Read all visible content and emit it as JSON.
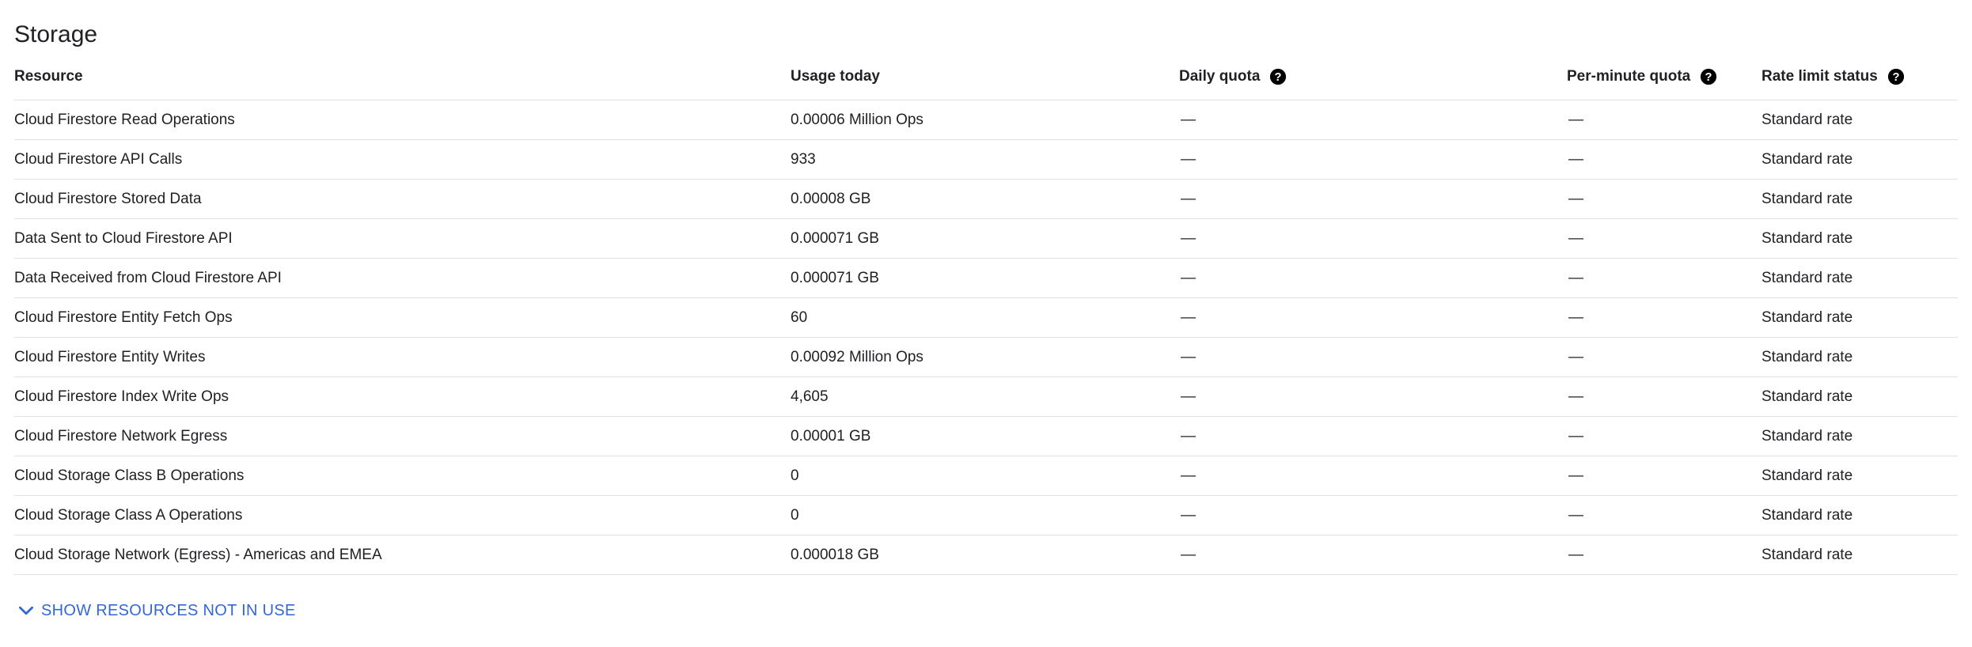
{
  "section": {
    "title": "Storage"
  },
  "table": {
    "headers": {
      "resource": "Resource",
      "usage": "Usage today",
      "daily_quota": "Daily quota",
      "per_minute_quota": "Per-minute quota",
      "rate_limit_status": "Rate limit status"
    },
    "rows": [
      {
        "resource": "Cloud Firestore Read Operations",
        "usage": "0.00006 Million Ops",
        "daily": "—",
        "per_minute": "—",
        "status": "Standard rate"
      },
      {
        "resource": "Cloud Firestore API Calls",
        "usage": "933",
        "daily": "—",
        "per_minute": "—",
        "status": "Standard rate"
      },
      {
        "resource": "Cloud Firestore Stored Data",
        "usage": "0.00008 GB",
        "daily": "—",
        "per_minute": "—",
        "status": "Standard rate"
      },
      {
        "resource": "Data Sent to Cloud Firestore API",
        "usage": "0.000071 GB",
        "daily": "—",
        "per_minute": "—",
        "status": "Standard rate"
      },
      {
        "resource": "Data Received from Cloud Firestore API",
        "usage": "0.000071 GB",
        "daily": "—",
        "per_minute": "—",
        "status": "Standard rate"
      },
      {
        "resource": "Cloud Firestore Entity Fetch Ops",
        "usage": "60",
        "daily": "—",
        "per_minute": "—",
        "status": "Standard rate"
      },
      {
        "resource": "Cloud Firestore Entity Writes",
        "usage": "0.00092 Million Ops",
        "daily": "—",
        "per_minute": "—",
        "status": "Standard rate"
      },
      {
        "resource": "Cloud Firestore Index Write Ops",
        "usage": "4,605",
        "daily": "—",
        "per_minute": "—",
        "status": "Standard rate"
      },
      {
        "resource": "Cloud Firestore Network Egress",
        "usage": "0.00001 GB",
        "daily": "—",
        "per_minute": "—",
        "status": "Standard rate"
      },
      {
        "resource": "Cloud Storage Class B Operations",
        "usage": "0",
        "daily": "—",
        "per_minute": "—",
        "status": "Standard rate"
      },
      {
        "resource": "Cloud Storage Class A Operations",
        "usage": "0",
        "daily": "—",
        "per_minute": "—",
        "status": "Standard rate"
      },
      {
        "resource": "Cloud Storage Network (Egress) - Americas and EMEA",
        "usage": "0.000018 GB",
        "daily": "—",
        "per_minute": "—",
        "status": "Standard rate"
      }
    ]
  },
  "footer": {
    "show_more_label": "SHOW RESOURCES NOT IN USE",
    "show_more_icon": "chevron-down-icon"
  },
  "colors": {
    "link": "#3367d6",
    "text": "#202124",
    "divider": "#e0e0e0"
  },
  "icons": {
    "help": "help-circle-icon"
  }
}
